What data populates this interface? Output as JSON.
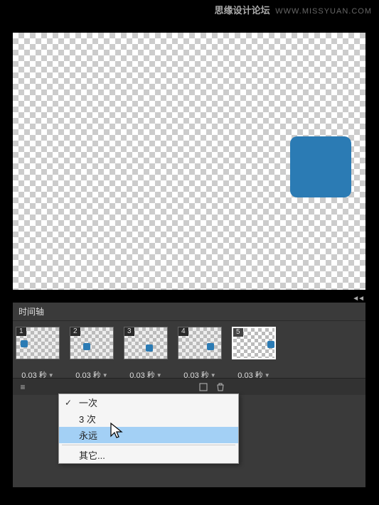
{
  "watermark": {
    "text": "思缘设计论坛",
    "url": "WWW.MISSYUAN.COM"
  },
  "panel": {
    "title": "时间轴"
  },
  "frames": [
    {
      "number": "1",
      "delay": "0.03 秒",
      "selected": false
    },
    {
      "number": "2",
      "delay": "0.03 秒",
      "selected": false
    },
    {
      "number": "3",
      "delay": "0.03 秒",
      "selected": false
    },
    {
      "number": "4",
      "delay": "0.03 秒",
      "selected": false
    },
    {
      "number": "5",
      "delay": "0.03 秒",
      "selected": true
    }
  ],
  "menu": {
    "items": [
      {
        "label": "一次",
        "checked": true,
        "highlighted": false
      },
      {
        "label": "3 次",
        "checked": false,
        "highlighted": false
      },
      {
        "label": "永远",
        "checked": false,
        "highlighted": true
      },
      {
        "label": "其它...",
        "checked": false,
        "highlighted": false
      }
    ]
  },
  "colors": {
    "accent": "#2b7bb4",
    "panel_bg": "#3a3a3a",
    "highlight": "#a3d0f5"
  }
}
